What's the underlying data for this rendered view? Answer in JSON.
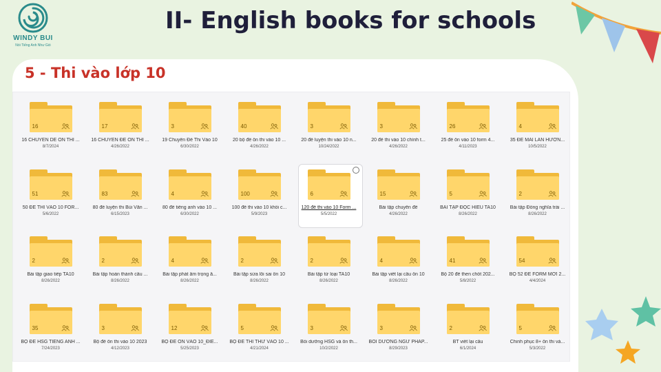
{
  "logo": {
    "name": "WINDY BUI",
    "tagline": "Nói Tiếng Anh Như Gió"
  },
  "header": {
    "title": "II- English books for schools",
    "subtitle": "5 - Thi vào lớp 10"
  },
  "colors": {
    "background": "#e9f3e1",
    "title": "#1f1f3a",
    "subtitle": "#c83228",
    "folder_front": "#ffd66b",
    "folder_back": "#f0b93a"
  },
  "folders": [
    {
      "count": "16",
      "name": "16 CHUYEN DE ON THI ...",
      "date": "8/7/2024"
    },
    {
      "count": "17",
      "name": "16 CHUYÊN ĐỀ ÔN THI ...",
      "date": "4/26/2022"
    },
    {
      "count": "3",
      "name": "19 Chuyên Đề Thi Vào 10",
      "date": "6/30/2022"
    },
    {
      "count": "40",
      "name": "20 bộ đề ôn thi vào 10 ...",
      "date": "4/26/2022"
    },
    {
      "count": "3",
      "name": "20 đề luyện thi vào 10 n...",
      "date": "10/24/2022"
    },
    {
      "count": "3",
      "name": "20 đề thi vào 10 chính t...",
      "date": "4/26/2022"
    },
    {
      "count": "26",
      "name": "25 đề ôn vào 10 form 4...",
      "date": "4/11/2023"
    },
    {
      "count": "4",
      "name": "35 ĐỀ MAI LAN HƯƠN...",
      "date": "10/5/2022"
    },
    {
      "count": "51",
      "name": "50 ĐỀ THI VÀO 10 FOR...",
      "date": "5/6/2022"
    },
    {
      "count": "83",
      "name": "80 đề luyện thi Bùi Văn ...",
      "date": "6/15/2023"
    },
    {
      "count": "4",
      "name": "80 đề tiếng anh vào 10 ...",
      "date": "6/30/2022"
    },
    {
      "count": "100",
      "name": "100 đề thi vào 10 khối c...",
      "date": "5/9/2023"
    },
    {
      "count": "6",
      "name": "120 đề thi vào 10 Form ...",
      "date": "5/5/2022",
      "selected": true
    },
    {
      "count": "15",
      "name": "Bài tập chuyên đề",
      "date": "4/26/2022"
    },
    {
      "count": "5",
      "name": "BÀI TẬP ĐỌC HIỂU TA10",
      "date": "8/26/2022"
    },
    {
      "count": "2",
      "name": "Bài tập Đồng nghĩa trái ...",
      "date": "8/26/2022"
    },
    {
      "count": "2",
      "name": "Bài tập giao tiếp TA10",
      "date": "8/26/2022"
    },
    {
      "count": "2",
      "name": "Bài tập hoàn thành câu ...",
      "date": "8/26/2022"
    },
    {
      "count": "4",
      "name": "Bài tập phát âm trọng â...",
      "date": "8/26/2022"
    },
    {
      "count": "2",
      "name": "Bài tập sửa lỗi sai ôn 10",
      "date": "8/26/2022"
    },
    {
      "count": "2",
      "name": "Bài tập từ loại TA10",
      "date": "8/26/2022"
    },
    {
      "count": "4",
      "name": "Bài tập viết lại câu ôn 10",
      "date": "8/26/2022"
    },
    {
      "count": "41",
      "name": "Bộ 20 đề then chốt 202...",
      "date": "5/8/2022"
    },
    {
      "count": "54",
      "name": "BỘ 52 ĐỀ FORM MỚI 2...",
      "date": "4/4/2024"
    },
    {
      "count": "35",
      "name": "BỘ ĐỀ HSG TIẾNG ANH ...",
      "date": "7/24/2023"
    },
    {
      "count": "3",
      "name": "Bộ đề ôn thi vào 10 2023",
      "date": "4/12/2023"
    },
    {
      "count": "12",
      "name": "BỘ ĐỀ ÔN VÀO 10_ĐIỂ...",
      "date": "5/25/2023"
    },
    {
      "count": "5",
      "name": "BỘ ĐỀ THI THỬ VÀO 10 ...",
      "date": "4/21/2024"
    },
    {
      "count": "3",
      "name": "Bồi dưỡng HSG và ôn th...",
      "date": "10/2/2022"
    },
    {
      "count": "3",
      "name": "BỒI DƯỠNG NGỮ PHÁP...",
      "date": "8/29/2023"
    },
    {
      "count": "2",
      "name": "BT viết lại câu",
      "date": "6/1/2024"
    },
    {
      "count": "5",
      "name": "Chinh phục 8+ ôn thi và...",
      "date": "5/3/2022"
    }
  ]
}
